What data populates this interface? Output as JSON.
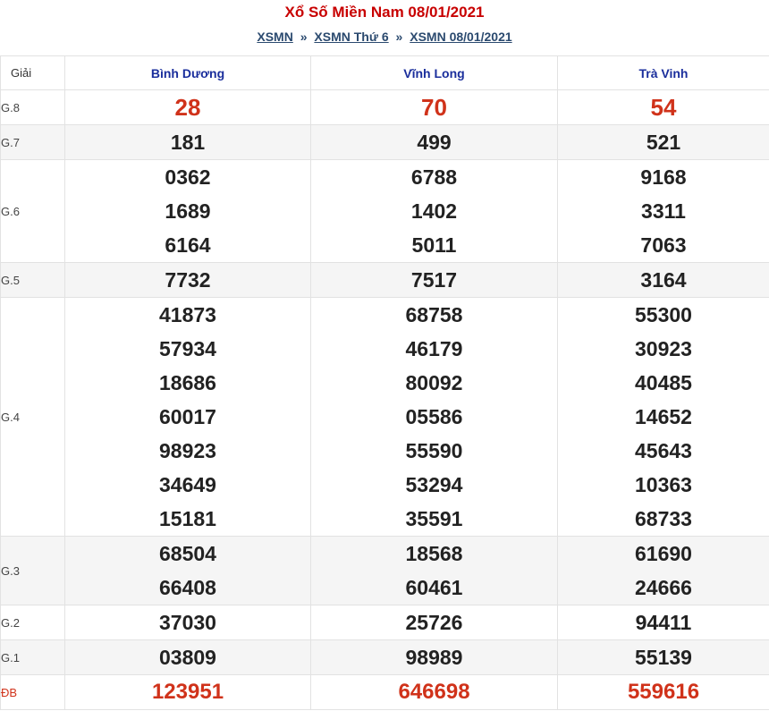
{
  "header": {
    "title": "Xổ Số Miền Nam 08/01/2021",
    "breadcrumb": [
      {
        "label": "XSMN"
      },
      {
        "label": "XSMN Thứ 6"
      },
      {
        "label": "XSMN 08/01/2021"
      }
    ],
    "separator": "»"
  },
  "table": {
    "label_header": "Giải",
    "provinces": [
      "Bình Dương",
      "Vĩnh Long",
      "Trà Vinh"
    ],
    "rows": [
      {
        "prize": "G.8",
        "values": [
          [
            "28"
          ],
          [
            "70"
          ],
          [
            "54"
          ]
        ]
      },
      {
        "prize": "G.7",
        "values": [
          [
            "181"
          ],
          [
            "499"
          ],
          [
            "521"
          ]
        ]
      },
      {
        "prize": "G.6",
        "values": [
          [
            "0362",
            "1689",
            "6164"
          ],
          [
            "6788",
            "1402",
            "5011"
          ],
          [
            "9168",
            "3311",
            "7063"
          ]
        ]
      },
      {
        "prize": "G.5",
        "values": [
          [
            "7732"
          ],
          [
            "7517"
          ],
          [
            "3164"
          ]
        ]
      },
      {
        "prize": "G.4",
        "values": [
          [
            "41873",
            "57934",
            "18686",
            "60017",
            "98923",
            "34649",
            "15181"
          ],
          [
            "68758",
            "46179",
            "80092",
            "05586",
            "55590",
            "53294",
            "35591"
          ],
          [
            "55300",
            "30923",
            "40485",
            "14652",
            "45643",
            "10363",
            "68733"
          ]
        ]
      },
      {
        "prize": "G.3",
        "values": [
          [
            "68504",
            "66408"
          ],
          [
            "18568",
            "60461"
          ],
          [
            "61690",
            "24666"
          ]
        ]
      },
      {
        "prize": "G.2",
        "values": [
          [
            "37030"
          ],
          [
            "25726"
          ],
          [
            "94411"
          ]
        ]
      },
      {
        "prize": "G.1",
        "values": [
          [
            "03809"
          ],
          [
            "98989"
          ],
          [
            "55139"
          ]
        ]
      },
      {
        "prize": "ĐB",
        "values": [
          [
            "123951"
          ],
          [
            "646698"
          ],
          [
            "559616"
          ]
        ]
      }
    ]
  },
  "colors": {
    "title": "#c80000",
    "link": "#2b4a6f",
    "province": "#1a2e9c",
    "highlight": "#d0321a",
    "alt_row": "#f5f5f5"
  }
}
